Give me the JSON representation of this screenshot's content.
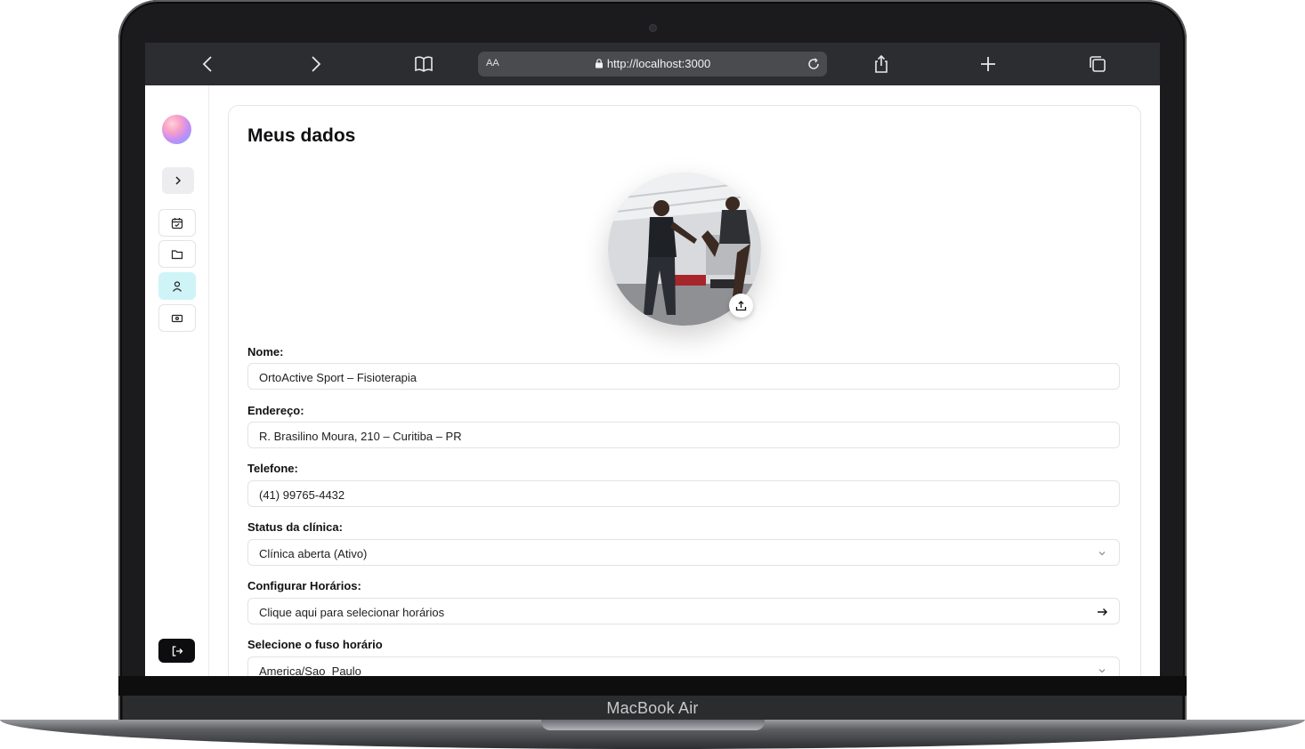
{
  "device": {
    "brand_label": "MacBook Air"
  },
  "browser": {
    "reader_label": "AA",
    "url": "http://localhost:3000"
  },
  "sidebar": {
    "items": [
      {
        "icon": "calendar-check-icon",
        "active": false
      },
      {
        "icon": "folder-icon",
        "active": false
      },
      {
        "icon": "user-icon",
        "active": true
      },
      {
        "icon": "ticket-icon",
        "active": false
      }
    ],
    "logout_icon": "logout-icon"
  },
  "page": {
    "title": "Meus dados",
    "fields": {
      "nome": {
        "label": "Nome:",
        "value": "OrtoActive Sport – Fisioterapia"
      },
      "endereco": {
        "label": "Endereço:",
        "value": "R. Brasilino Moura, 210 – Curitiba – PR"
      },
      "telefone": {
        "label": "Telefone:",
        "value": "(41) 99765-4432"
      },
      "status": {
        "label": "Status da clínica:",
        "value": "Clínica aberta (Ativo)"
      },
      "horarios": {
        "label": "Configurar Horários:",
        "value": "Clique aqui para selecionar horários"
      },
      "fuso": {
        "label": "Selecione o fuso horário",
        "value": "America/Sao_Paulo"
      }
    }
  },
  "colors": {
    "active_nav": "#cff4f7",
    "logout_bg": "#0d0d0f",
    "browser_bar": "#2c2d30"
  }
}
